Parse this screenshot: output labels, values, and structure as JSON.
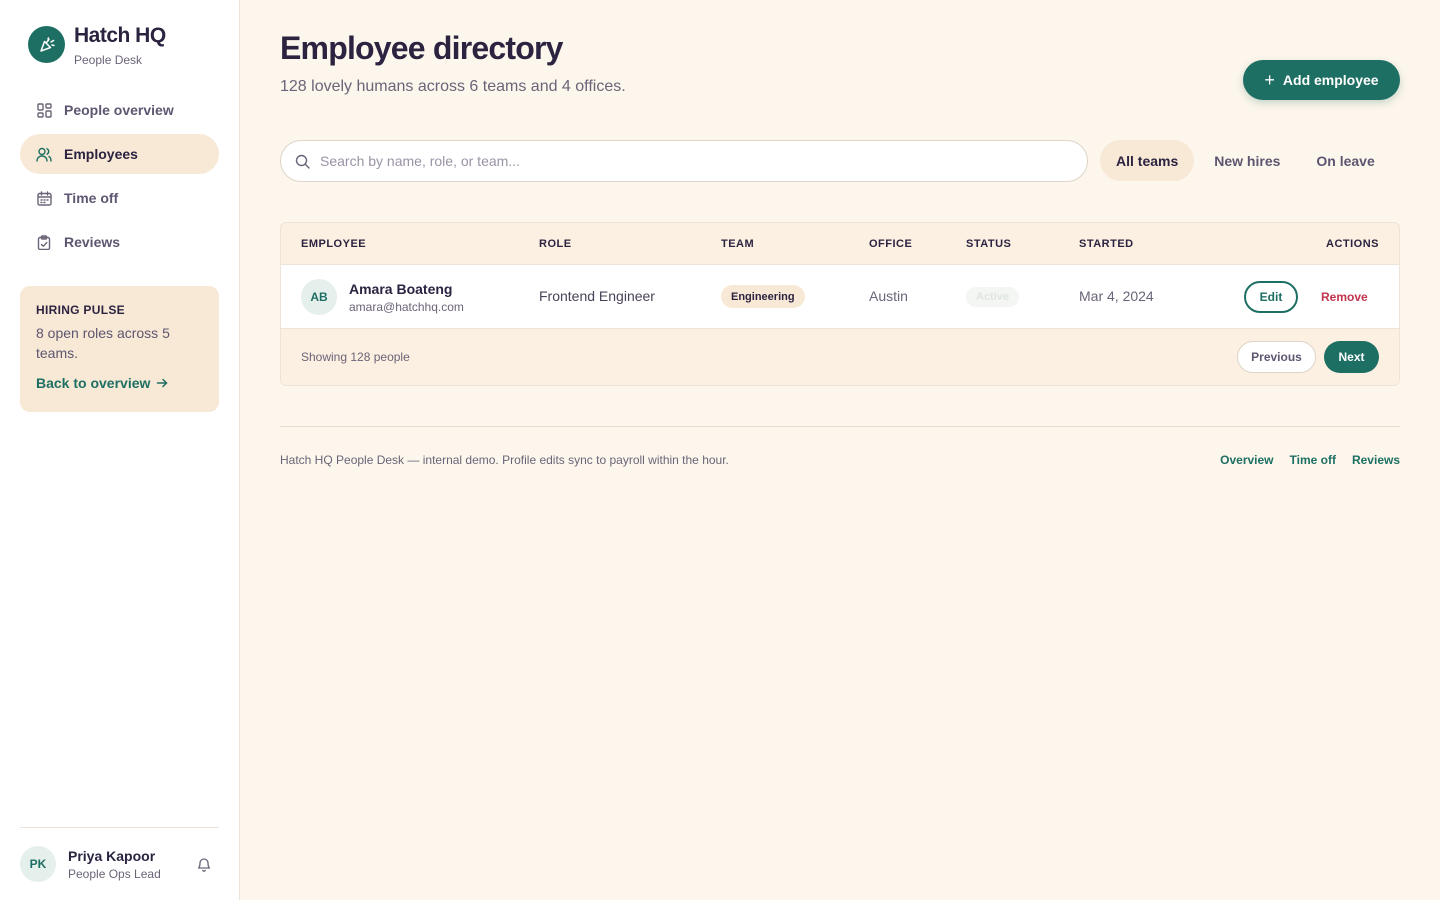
{
  "brand": {
    "name": "Hatch HQ",
    "subtitle": "People Desk",
    "accent": "#1e6f63"
  },
  "sidebar": {
    "items": [
      {
        "label": "People overview",
        "icon": "grid-icon",
        "active": false
      },
      {
        "label": "Employees",
        "icon": "users-icon",
        "active": true
      },
      {
        "label": "Time off",
        "icon": "calendar-icon",
        "active": false
      },
      {
        "label": "Reviews",
        "icon": "clipboard-check-icon",
        "active": false
      }
    ],
    "pulse": {
      "title": "HIRING PULSE",
      "body": "8 open roles across 5 teams.",
      "link": "Back to overview"
    },
    "user": {
      "initials": "PK",
      "name": "Priya Kapoor",
      "role": "People Ops Lead"
    }
  },
  "header": {
    "title": "Employee directory",
    "subtitle": "128 lovely humans across 6 teams and 4 offices.",
    "add_button": "Add employee"
  },
  "search": {
    "placeholder": "Search by name, role, or team...",
    "value": ""
  },
  "filters": [
    {
      "label": "All teams",
      "active": true
    },
    {
      "label": "New hires",
      "active": false
    },
    {
      "label": "On leave",
      "active": false
    }
  ],
  "table": {
    "columns": [
      "EMPLOYEE",
      "ROLE",
      "TEAM",
      "OFFICE",
      "STATUS",
      "STARTED",
      "ACTIONS"
    ],
    "rows": [
      {
        "initials": "AB",
        "name": "Amara Boateng",
        "email": "amara@hatchhq.com",
        "role": "Frontend Engineer",
        "team": "Engineering",
        "office": "Austin",
        "status": "Active",
        "started": "Mar 4, 2024",
        "edit": "Edit",
        "remove": "Remove"
      }
    ],
    "footer": {
      "showing": "Showing 128 people",
      "prev": "Previous",
      "next": "Next"
    }
  },
  "footer": {
    "text": "Hatch HQ People Desk — internal demo. Profile edits sync to payroll within the hour.",
    "links": [
      "Overview",
      "Time off",
      "Reviews"
    ]
  },
  "colors": {
    "background": "#fdf6ec",
    "accent": "#1e6f63",
    "highlight": "#f8e9d6",
    "danger": "#c2334d"
  }
}
